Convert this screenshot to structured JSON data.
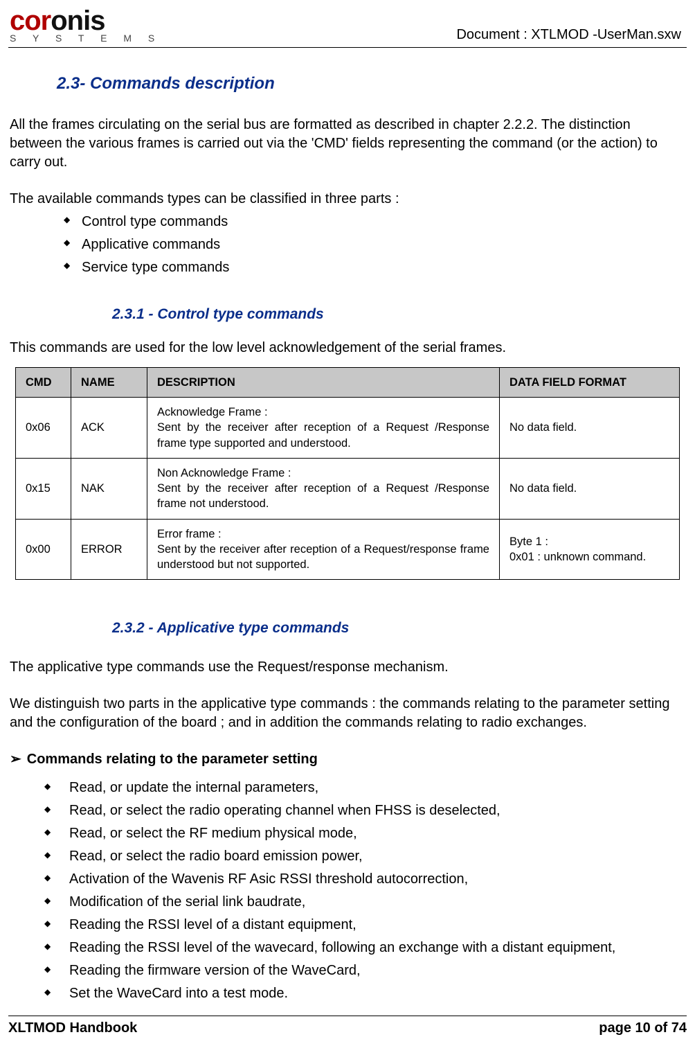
{
  "header": {
    "logo_main_red": "cor",
    "logo_main_black": "onis",
    "logo_sub": "S Y S T E M S",
    "doc_label": "Document : XTLMOD -UserMan.sxw"
  },
  "section_23": {
    "title": "2.3- Commands description",
    "intro_1": "All the frames circulating on the serial bus are formatted as described in chapter 2.2.2. The distinction between the various frames  is carried out via the 'CMD' fields representing the command (or the action) to carry out.",
    "intro_2": "The available commands types can be classified in three parts :",
    "types": [
      "Control type commands",
      "Applicative commands",
      "Service type commands"
    ]
  },
  "section_231": {
    "title": "2.3.1 - Control type commands",
    "intro": "This commands are used for the low level acknowledgement of the serial frames.",
    "table": {
      "headers": {
        "cmd": "CMD",
        "name": "NAME",
        "desc": "DESCRIPTION",
        "data": "DATA FIELD FORMAT"
      },
      "rows": [
        {
          "cmd": "0x06",
          "name": "ACK",
          "desc": "Acknowledge Frame :\nSent by the receiver after reception of a Request /Response frame type supported and understood.",
          "data": "No data field."
        },
        {
          "cmd": "0x15",
          "name": "NAK",
          "desc": "Non Acknowledge Frame :\nSent by the receiver after reception of a Request /Response frame  not understood.",
          "data": "No data field."
        },
        {
          "cmd": "0x00",
          "name": "ERROR",
          "desc": "Error frame :\nSent by the receiver after reception of a Request/response frame understood but not supported.",
          "data": "Byte 1 :\n0x01 : unknown command."
        }
      ]
    }
  },
  "section_232": {
    "title": "2.3.2 - Applicative type commands",
    "p1": "The applicative type commands use the Request/response mechanism.",
    "p2": "We distinguish two parts in the applicative type commands : the commands relating to the parameter setting and the configuration of the board ; and in addition the commands relating to radio exchanges.",
    "arrow_head": "Commands relating to the parameter setting",
    "bullets": [
      "Read, or update the internal parameters,",
      "Read, or select the radio operating channel when FHSS is deselected,",
      "Read, or select the RF medium  physical mode,",
      "Read, or select the radio board emission power,",
      "Activation of the Wavenis RF Asic RSSI threshold autocorrection,",
      "Modification of the serial link baudrate,",
      "Reading the RSSI level of a distant equipment,",
      "Reading the RSSI level of the wavecard, following an exchange with a distant equipment,",
      "Reading the firmware version of the WaveCard,",
      "Set the WaveCard into a test mode."
    ]
  },
  "footer": {
    "left": "XLTMOD Handbook",
    "right": "page 10 of 74"
  }
}
